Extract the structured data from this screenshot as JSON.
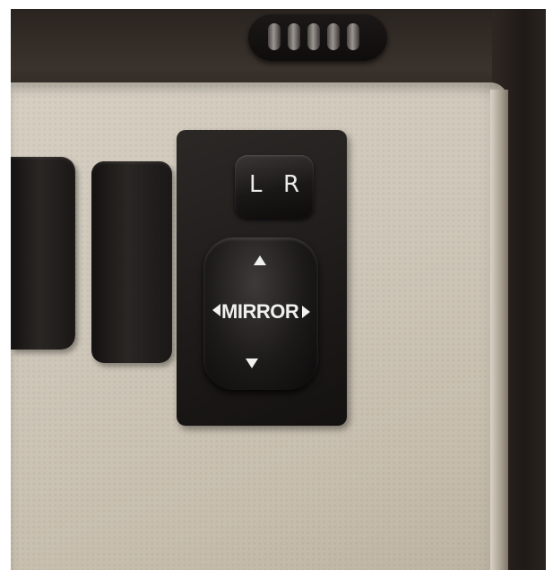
{
  "switch_panel": {
    "lr_selector": {
      "left_label": "L",
      "right_label": "R"
    },
    "mirror_control": {
      "label": "MIRROR",
      "arrows": [
        "up-arrow-icon",
        "down-arrow-icon",
        "left-arrow-icon",
        "right-arrow-icon"
      ]
    }
  },
  "colors": {
    "panel": "#cfc7b9",
    "buttons": "#1a1817",
    "label_text": "#f0f0f0"
  }
}
